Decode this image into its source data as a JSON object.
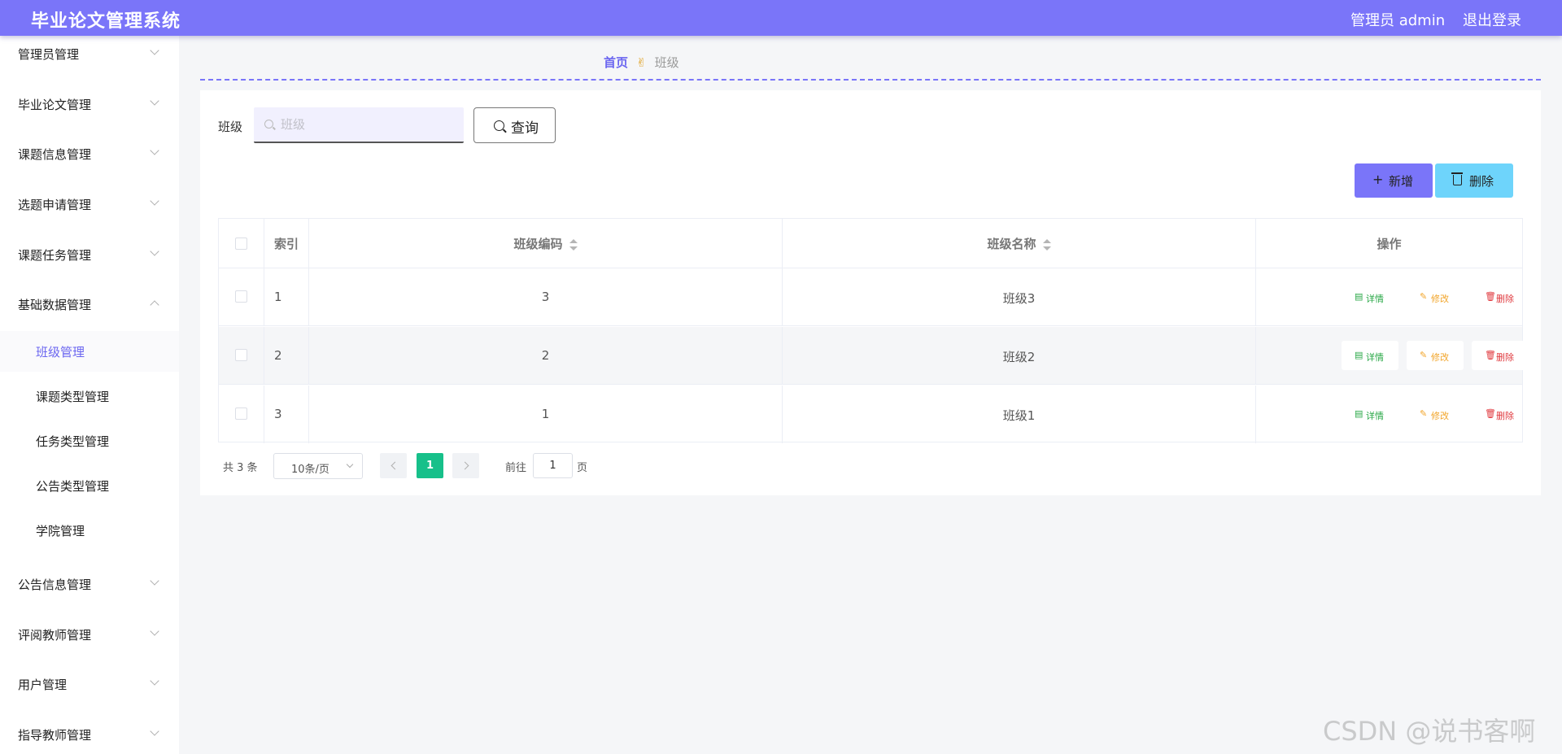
{
  "header": {
    "title": "毕业论文管理系统",
    "user": "管理员 admin",
    "logout": "退出登录"
  },
  "sidebar": {
    "items": [
      {
        "label": "管理员管理"
      },
      {
        "label": "毕业论文管理"
      },
      {
        "label": "课题信息管理"
      },
      {
        "label": "选题申请管理"
      },
      {
        "label": "课题任务管理"
      },
      {
        "label": "基础数据管理"
      },
      {
        "label": "公告信息管理"
      },
      {
        "label": "评阅教师管理"
      },
      {
        "label": "用户管理"
      },
      {
        "label": "指导教师管理"
      }
    ],
    "submenu": [
      {
        "label": "班级管理"
      },
      {
        "label": "课题类型管理"
      },
      {
        "label": "任务类型管理"
      },
      {
        "label": "公告类型管理"
      },
      {
        "label": "学院管理"
      }
    ]
  },
  "breadcrumb": {
    "home": "首页",
    "separator": "✌",
    "current": "班级"
  },
  "search": {
    "label": "班级",
    "placeholder": "班级",
    "query_label": "查询"
  },
  "toolbar": {
    "add_label": "新增",
    "delete_label": "删除"
  },
  "table": {
    "columns": [
      "索引",
      "班级编码",
      "班级名称",
      "操作"
    ],
    "rows": [
      {
        "index": "1",
        "code": "3",
        "name": "班级3"
      },
      {
        "index": "2",
        "code": "2",
        "name": "班级2"
      },
      {
        "index": "3",
        "code": "1",
        "name": "班级1"
      }
    ],
    "actions": {
      "detail": "详情",
      "edit": "修改",
      "remove": "删除"
    }
  },
  "pagination": {
    "total": "共 3 条",
    "page_size": "10条/页",
    "current_page": "1",
    "goto_label": "前往",
    "goto_value": "1",
    "goto_suffix": "页"
  },
  "watermark": "CSDN @说书客啊",
  "colors": {
    "header_bg": "#7a75f9",
    "accent": "#6b66f0",
    "add_button": "#7a75f9",
    "delete_button": "#6ed4fb",
    "current_page": "#17c08a",
    "detail": "#27a745",
    "edit": "#f2a52a",
    "remove": "#e0393e"
  }
}
